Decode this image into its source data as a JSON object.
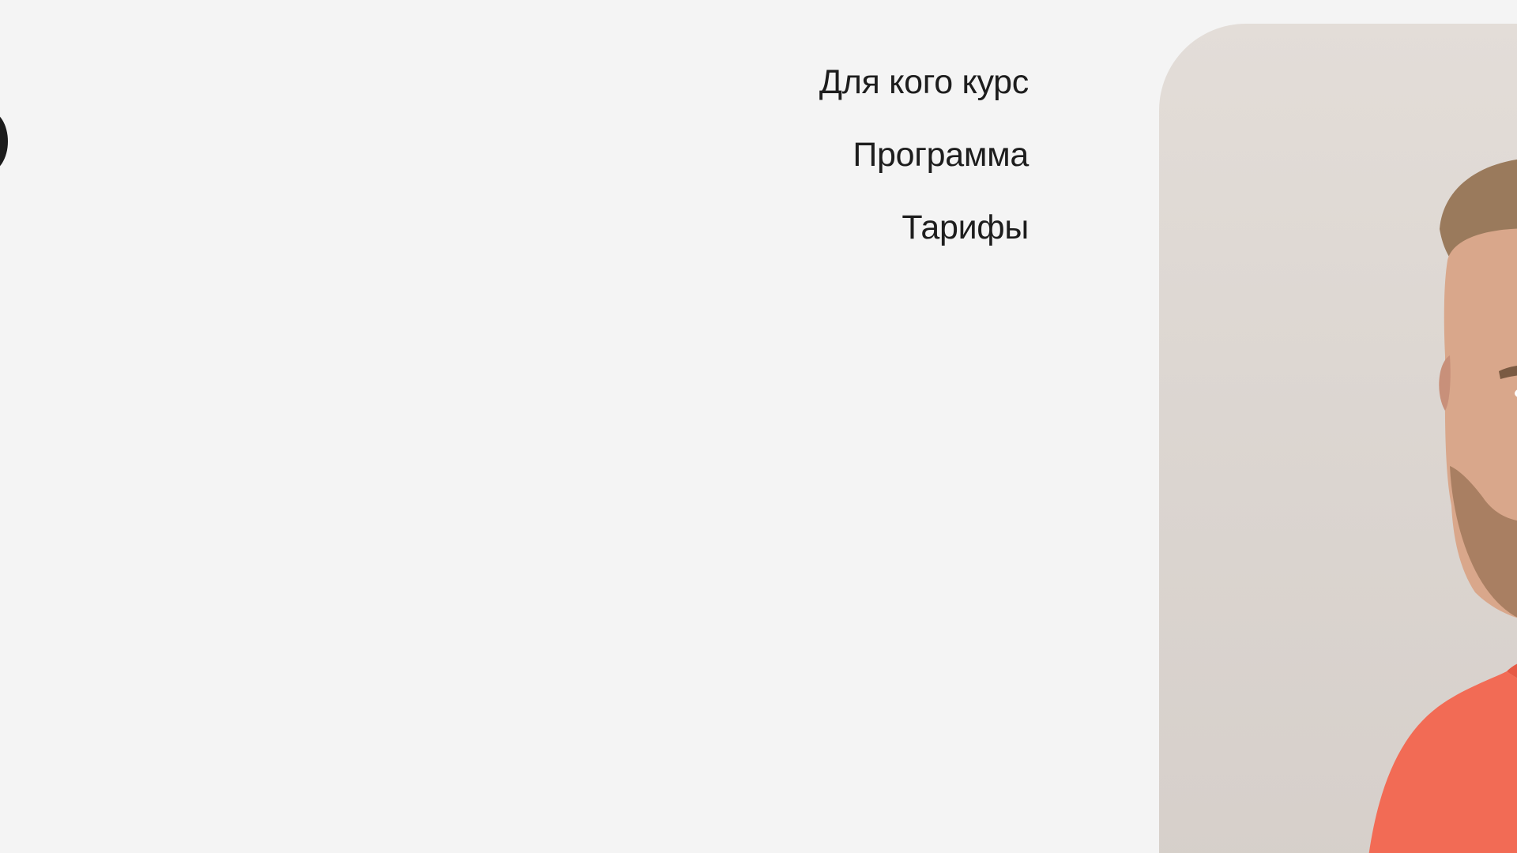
{
  "nav": {
    "items": [
      {
        "label": "Для кого курс"
      },
      {
        "label": "Программа"
      },
      {
        "label": "Тарифы"
      }
    ]
  },
  "colors": {
    "background": "#f4f4f4",
    "text": "#1d1d1d",
    "shirt": "#f26b55",
    "photo_bg": "#dcd6d1"
  },
  "icons": {
    "left_edge": "dark-circle"
  }
}
